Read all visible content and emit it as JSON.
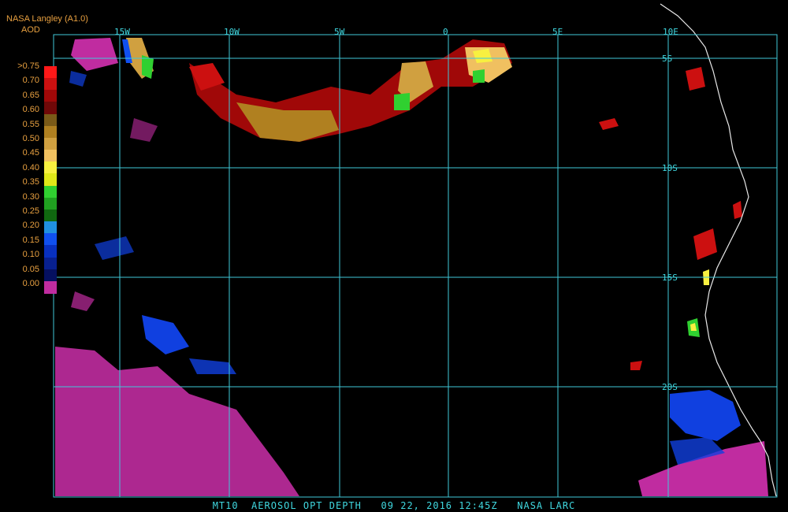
{
  "header": {
    "source": "NASA Langley (A1.0)",
    "product": "AOD"
  },
  "legend": {
    "labels": [
      ">0.75",
      "0.70",
      "0.65",
      "0.60",
      "0.55",
      "0.50",
      "0.45",
      "0.40",
      "0.35",
      "0.30",
      "0.25",
      "0.20",
      "0.15",
      "0.10",
      "0.05",
      "0.00"
    ],
    "colors": [
      "#ff1818",
      "#cc1010",
      "#a00808",
      "#700808",
      "#7a5a18",
      "#b08020",
      "#d0a040",
      "#f0c060",
      "#f8f040",
      "#e0e818",
      "#30d030",
      "#20a020",
      "#106810",
      "#2090e0",
      "#1050f0",
      "#0830c0",
      "#082090",
      "#051060",
      "#c02ca0"
    ]
  },
  "grid": {
    "lon_labels": [
      "15W",
      "10W",
      "5W",
      "0",
      "5E",
      "10E"
    ],
    "lat_labels": [
      "5S",
      "10S",
      "15S",
      "20S"
    ]
  },
  "footer": "MT10  AEROSOL OPT DEPTH   09 22, 2016 12:45Z   NASA LARC"
}
